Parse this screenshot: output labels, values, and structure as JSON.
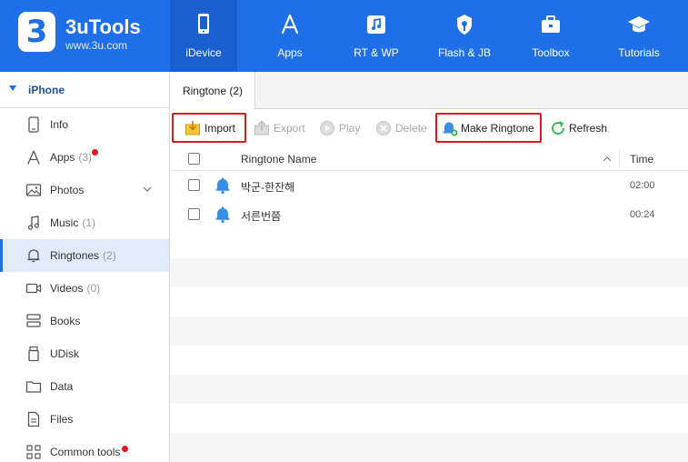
{
  "app": {
    "logo_mark": "3",
    "name": "3uTools",
    "site": "www.3u.com",
    "accent_color": "#1f70e8"
  },
  "nav": [
    {
      "label": "iDevice",
      "icon": "phone-icon",
      "active": true
    },
    {
      "label": "Apps",
      "icon": "app-store-icon"
    },
    {
      "label": "RT & WP",
      "icon": "music-note-icon"
    },
    {
      "label": "Flash & JB",
      "icon": "flash-key-icon"
    },
    {
      "label": "Toolbox",
      "icon": "toolbox-icon"
    },
    {
      "label": "Tutorials",
      "icon": "graduation-cap-icon"
    }
  ],
  "sidebar": {
    "device": "iPhone",
    "items": [
      {
        "label": "Info",
        "icon": "phone-outline-icon",
        "count": ""
      },
      {
        "label": "Apps",
        "icon": "app-icon",
        "count": "(3)",
        "badge": true
      },
      {
        "label": "Photos",
        "icon": "photo-icon",
        "count": "",
        "expandable": true
      },
      {
        "label": "Music",
        "icon": "music-icon",
        "count": "(1)"
      },
      {
        "label": "Ringtones",
        "icon": "bell-icon",
        "count": "(2)",
        "active": true
      },
      {
        "label": "Videos",
        "icon": "video-icon",
        "count": "(0)"
      },
      {
        "label": "Books",
        "icon": "book-icon",
        "count": ""
      },
      {
        "label": "UDisk",
        "icon": "usb-icon",
        "count": ""
      },
      {
        "label": "Data",
        "icon": "folder-icon",
        "count": ""
      },
      {
        "label": "Files",
        "icon": "file-icon",
        "count": ""
      },
      {
        "label": "Common tools",
        "icon": "grid-icon",
        "count": "",
        "badge": true
      }
    ]
  },
  "tab": {
    "label": "Ringtone (2)"
  },
  "toolbar": {
    "import": "Import",
    "export": "Export",
    "play": "Play",
    "delete": "Delete",
    "make_ringtone": "Make Ringtone",
    "refresh": "Refresh"
  },
  "table": {
    "columns": {
      "name": "Ringtone Name",
      "time": "Time"
    },
    "rows": [
      {
        "name": "박군-한잔해",
        "time": "02:00"
      },
      {
        "name": "서른번쯤",
        "time": "00:24"
      }
    ]
  }
}
